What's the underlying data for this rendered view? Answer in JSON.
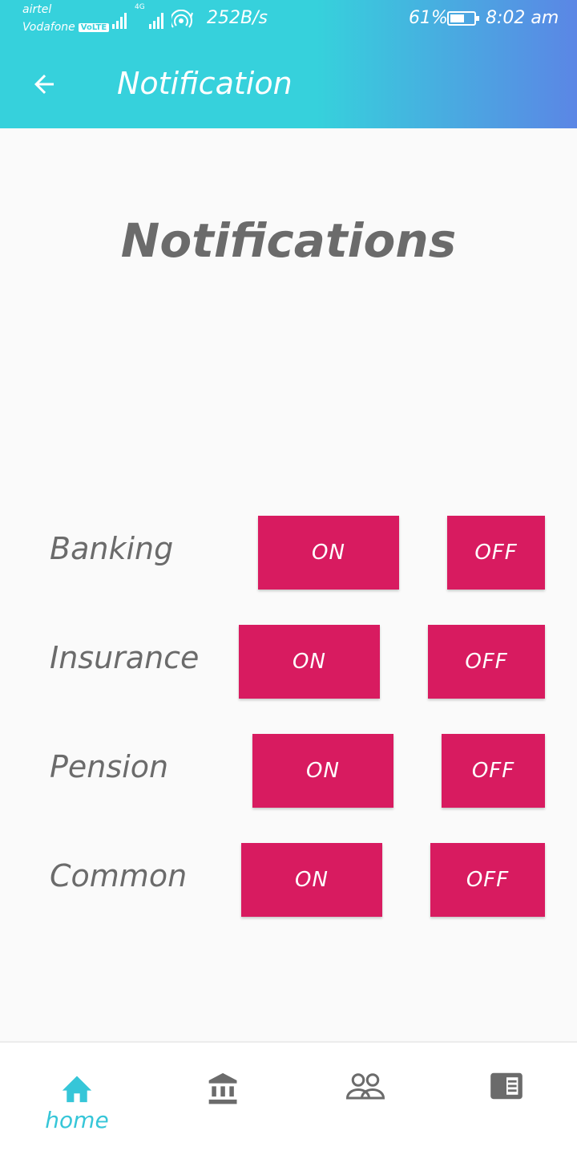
{
  "status_bar": {
    "carrier_1": "airtel",
    "carrier_2": "Vodafone",
    "volte_badge": "VoLTE",
    "network_badge": "4G",
    "speed": "252B/s",
    "battery_percent": "61%",
    "battery_level": 0.61,
    "time": "8:02 am"
  },
  "app_bar": {
    "title": "Notification",
    "back_icon": "arrow-back-icon"
  },
  "page": {
    "heading": "Notifications"
  },
  "settings": [
    {
      "label": "Banking",
      "on_label": "ON",
      "off_label": "OFF"
    },
    {
      "label": "Insurance",
      "on_label": "ON",
      "off_label": "OFF"
    },
    {
      "label": "Pension",
      "on_label": "ON",
      "off_label": "OFF"
    },
    {
      "label": "Common",
      "on_label": "ON",
      "off_label": "OFF"
    }
  ],
  "bottom_nav": {
    "items": [
      {
        "label": "home",
        "icon": "home-icon",
        "active": true
      },
      {
        "label": "",
        "icon": "bank-icon",
        "active": false
      },
      {
        "label": "",
        "icon": "people-icon",
        "active": false
      },
      {
        "label": "",
        "icon": "news-icon",
        "active": false
      }
    ]
  },
  "colors": {
    "header_start": "#36d1dc",
    "header_end": "#5b86e5",
    "button": "#d81b60",
    "text": "#6b6b6b",
    "accent": "#36c6d8",
    "nav_inactive": "#6b6b6b"
  }
}
